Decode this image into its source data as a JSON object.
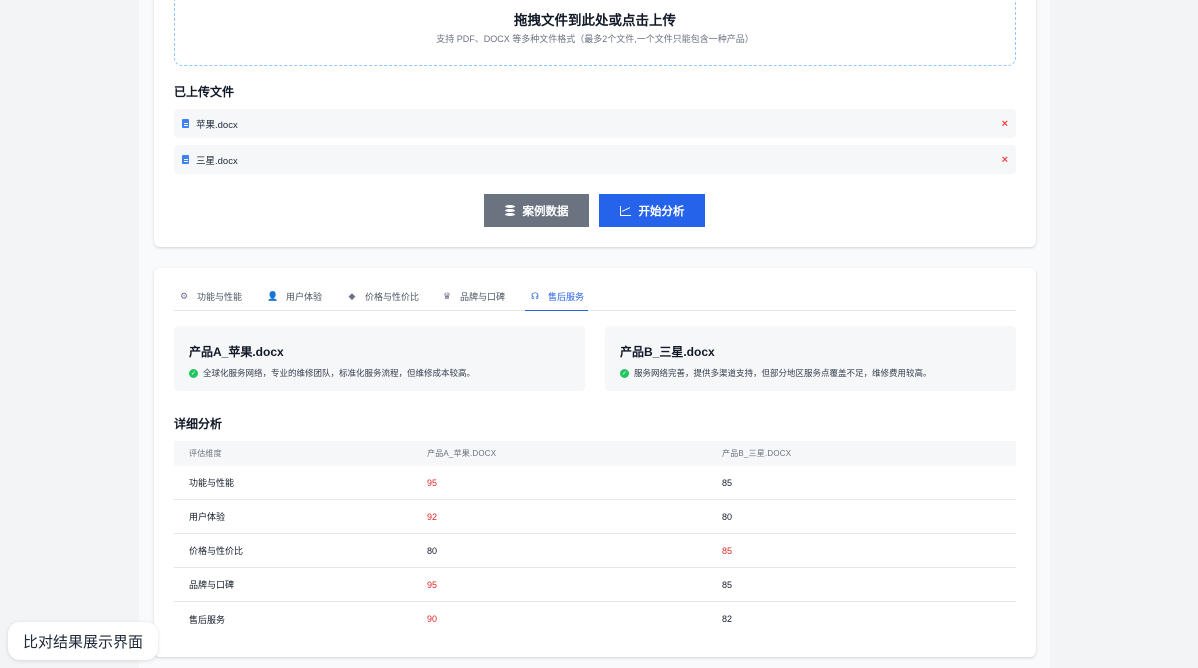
{
  "upload": {
    "title": "拖拽文件到此处或点击上传",
    "hint": "支持 PDF、DOCX 等多种文件格式（最多2个文件,一个文件只能包含一种产品）"
  },
  "uploaded": {
    "title": "已上传文件",
    "files": [
      {
        "name": "苹果.docx",
        "remove": "×"
      },
      {
        "name": "三星.docx",
        "remove": "×"
      }
    ]
  },
  "actions": {
    "sample_label": "案例数据",
    "analyze_label": "开始分析"
  },
  "tabs": [
    {
      "label": "功能与性能",
      "icon": "gears-icon",
      "glyph": "⚙"
    },
    {
      "label": "用户体验",
      "icon": "user-check-icon",
      "glyph": "👤"
    },
    {
      "label": "价格与性价比",
      "icon": "tag-icon",
      "glyph": "◆"
    },
    {
      "label": "品牌与口碑",
      "icon": "crown-icon",
      "glyph": "♛"
    },
    {
      "label": "售后服务",
      "icon": "headset-icon",
      "glyph": "☊",
      "active": true
    }
  ],
  "summaries": [
    {
      "product": "产品A_苹果.docx",
      "desc": "全球化服务网络，专业的维修团队，标准化服务流程，但维修成本较高。"
    },
    {
      "product": "产品B_三星.docx",
      "desc": "服务网络完善，提供多渠道支持，但部分地区服务点覆盖不足，维修费用较高。"
    }
  ],
  "detail": {
    "title": "详细分析",
    "headers": [
      "评估维度",
      "产品A_苹果.DOCX",
      "产品B_三星.DOCX"
    ],
    "rows": [
      {
        "dim": "功能与性能",
        "a": "95",
        "b": "85",
        "a_high": true,
        "b_high": false
      },
      {
        "dim": "用户体验",
        "a": "92",
        "b": "80",
        "a_high": true,
        "b_high": false
      },
      {
        "dim": "价格与性价比",
        "a": "80",
        "b": "85",
        "a_high": false,
        "b_high": true
      },
      {
        "dim": "品牌与口碑",
        "a": "95",
        "b": "85",
        "a_high": true,
        "b_high": false
      },
      {
        "dim": "售后服务",
        "a": "90",
        "b": "82",
        "a_high": true,
        "b_high": false
      }
    ]
  },
  "caption": "比对结果展示界面",
  "colors": {
    "accent": "#2563eb",
    "highlight": "#dc2626",
    "success": "#22c55e",
    "remove": "#ef4444"
  }
}
